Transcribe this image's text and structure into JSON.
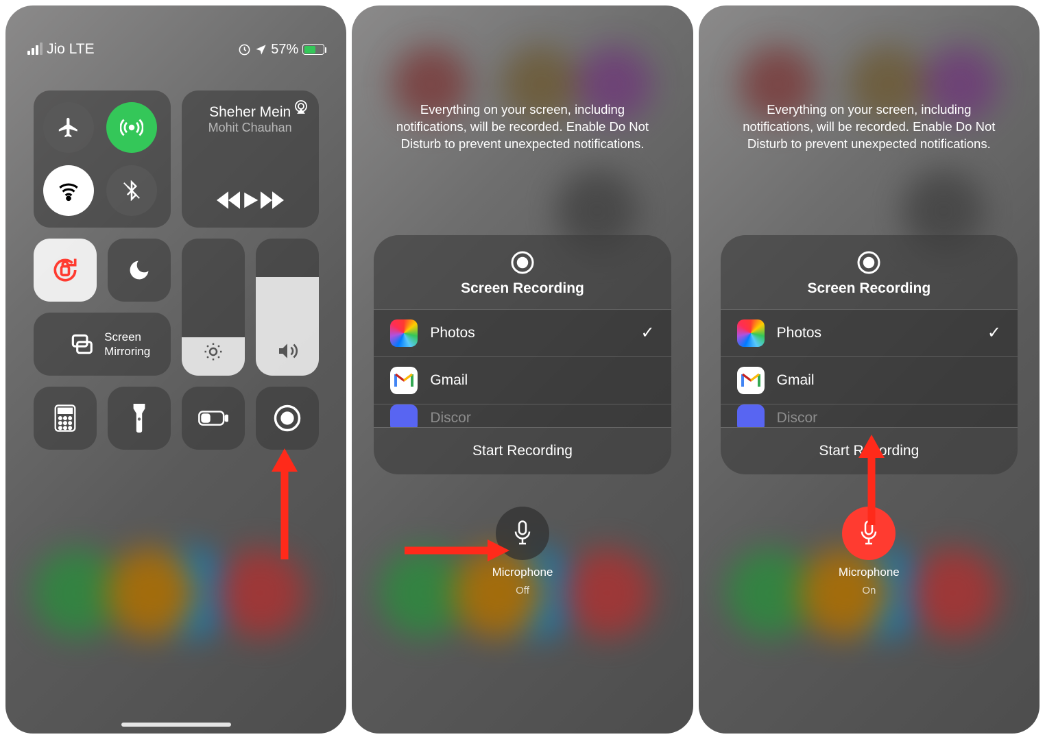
{
  "status": {
    "carrier": "Jio LTE",
    "battery_pct": "57%"
  },
  "connectivity": {
    "airplane_icon": "airplane-icon",
    "cellular_icon": "cellular-icon",
    "wifi_icon": "wifi-icon",
    "bluetooth_icon": "bluetooth-icon"
  },
  "media": {
    "title": "Sheher Mein",
    "artist": "Mohit Chauhan"
  },
  "controls": {
    "screen_mirroring_label": "Screen\nMirroring"
  },
  "recording": {
    "notice": "Everything on your screen, including notifications, will be recorded. Enable Do Not Disturb to prevent unexpected notifications.",
    "sheet_title": "Screen Recording",
    "apps": [
      {
        "name": "Photos",
        "selected": true
      },
      {
        "name": "Gmail",
        "selected": false
      },
      {
        "name": "Discor",
        "selected": false
      }
    ],
    "start_label": "Start Recording"
  },
  "mic": {
    "label": "Microphone",
    "state_off": "Off",
    "state_on": "On"
  }
}
